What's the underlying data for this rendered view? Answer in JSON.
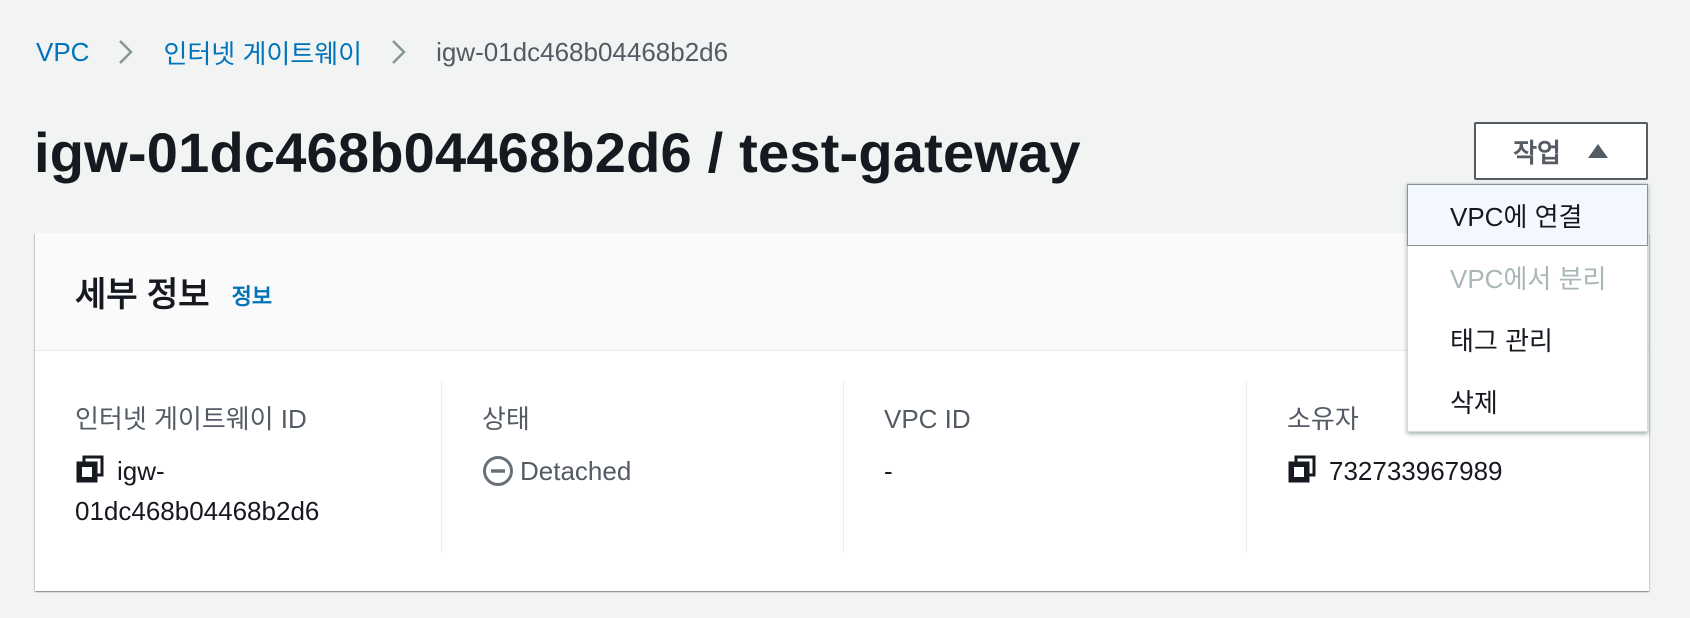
{
  "breadcrumb": {
    "items": [
      {
        "label": "VPC"
      },
      {
        "label": "인터넷 게이트웨이"
      },
      {
        "label": "igw-01dc468b04468b2d6"
      }
    ]
  },
  "page": {
    "title": "igw-01dc468b04468b2d6 / test-gateway"
  },
  "actions": {
    "label": "작업",
    "menu_items": [
      {
        "label": "VPC에 연결",
        "state": "highlighted"
      },
      {
        "label": "VPC에서 분리",
        "state": "disabled"
      },
      {
        "label": "태그 관리",
        "state": "enabled"
      },
      {
        "label": "삭제",
        "state": "enabled"
      }
    ]
  },
  "details": {
    "title": "세부 정보",
    "info_link": "정보",
    "columns": [
      {
        "label": "인터넷 게이트웨이 ID",
        "value_line1": "igw-",
        "value_line2": "01dc468b04468b2d6",
        "icon": "copy-icon"
      },
      {
        "label": "상태",
        "value": "Detached",
        "icon": "minus-circle-icon"
      },
      {
        "label": "VPC ID",
        "value": "-"
      },
      {
        "label": "소유자",
        "value": "732733967989",
        "icon": "copy-icon"
      }
    ]
  },
  "colors": {
    "link": "#0073bb",
    "text": "#16191f",
    "secondary_text": "#545b64",
    "disabled_text": "#aab7b8",
    "page_background": "#f2f3f3"
  }
}
